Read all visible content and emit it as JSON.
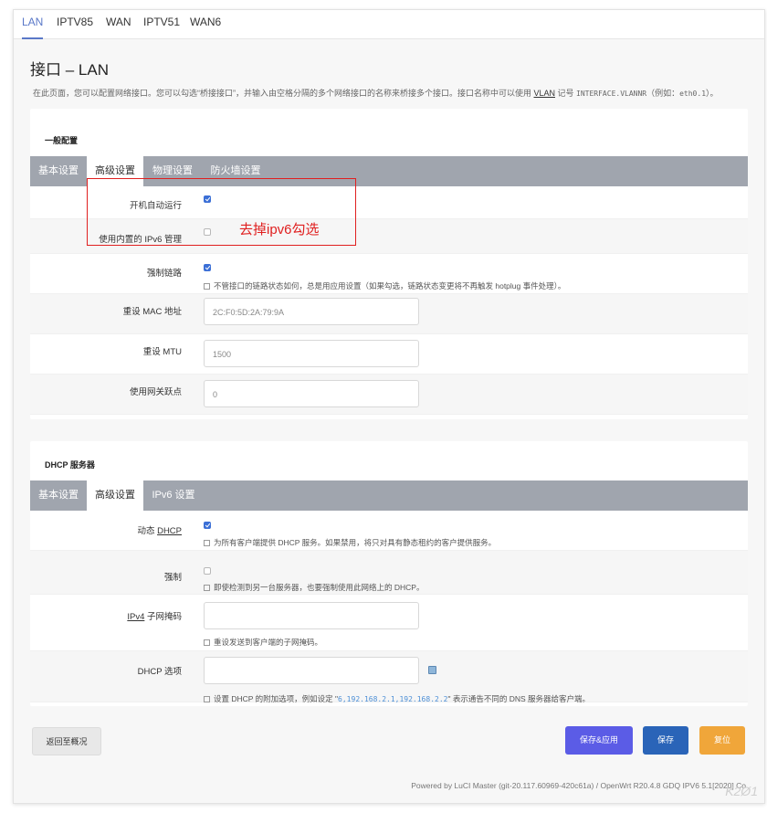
{
  "top_tabs": [
    "LAN",
    "IPTV85",
    "WAN",
    "IPTV51",
    "WAN6"
  ],
  "page": {
    "title": "接口 – LAN",
    "description_part1": "在此页面，您可以配置网络接口。您可以勾选“桥接接口”，并输入由空格分隔的多个网络接口的名称来桥接多个接口。接口名称中可以使用 ",
    "description_vlan": "VLAN",
    "description_part2": " 记号 ",
    "description_mono": "INTERFACE.VLANNR",
    "description_part3": "（例如：",
    "description_example": "eth0.1",
    "description_part4": "）。"
  },
  "general": {
    "title": "一般配置",
    "tabs": [
      "基本设置",
      "高级设置",
      "物理设置",
      "防火墙设置"
    ],
    "rows": {
      "autostart_label": "开机自动运行",
      "ipv6_label": "使用内置的 IPv6 管理",
      "force_link_label": "强制链路",
      "force_link_help": "不管接口的链路状态如何，总是用应用设置（如果勾选，链路状态变更将不再触发 hotplug 事件处理）。",
      "mac_label": "重设 MAC 地址",
      "mac_value": "2C:F0:5D:2A:79:9A",
      "mtu_label": "重设 MTU",
      "mtu_value": "1500",
      "metric_label": "使用网关跃点",
      "metric_value": "0"
    },
    "checked": {
      "autostart": true,
      "ipv6": false,
      "force_link": true
    }
  },
  "annotation": {
    "text": "去掉ipv6勾选",
    "color": "#e02020"
  },
  "dhcp": {
    "title": "DHCP 服务器",
    "tabs": [
      "基本设置",
      "高级设置",
      "IPv6 设置"
    ],
    "rows": {
      "dynamic_label_prefix": "动态 ",
      "dynamic_label_link": "DHCP",
      "dynamic_help": "为所有客户端提供 DHCP 服务。如果禁用，将只对具有静态租约的客户提供服务。",
      "force_label": "强制",
      "force_help": "即使检测到另一台服务器，也要强制使用此网络上的 DHCP。",
      "netmask_label_link": "IPv4",
      "netmask_label_suffix": " 子网掩码",
      "netmask_help": "重设发送到客户端的子网掩码。",
      "options_label": "DHCP 选项",
      "options_help_prefix": "设置 DHCP 的附加选项，例如设定 \"",
      "options_help_code": "6,192.168.2.1,192.168.2.2",
      "options_help_suffix": "\" 表示通告不同的 DNS 服务器给客户端。"
    },
    "checked": {
      "dynamic": true,
      "force": false
    }
  },
  "buttons": {
    "back": "返回至概况",
    "save_apply": "保存&应用",
    "save": "保存",
    "reset": "复位"
  },
  "colors": {
    "accent": "#5a78c8",
    "apply": "#5b5ce6",
    "save": "#2a64b8",
    "reset": "#f0a63a"
  },
  "footer": "Powered by LuCI Master (git-20.117.60969-420c61a) / OpenWrt R20.4.8 GDQ IPV6 5.1[2020] Co",
  "watermark": "K2Ø1"
}
